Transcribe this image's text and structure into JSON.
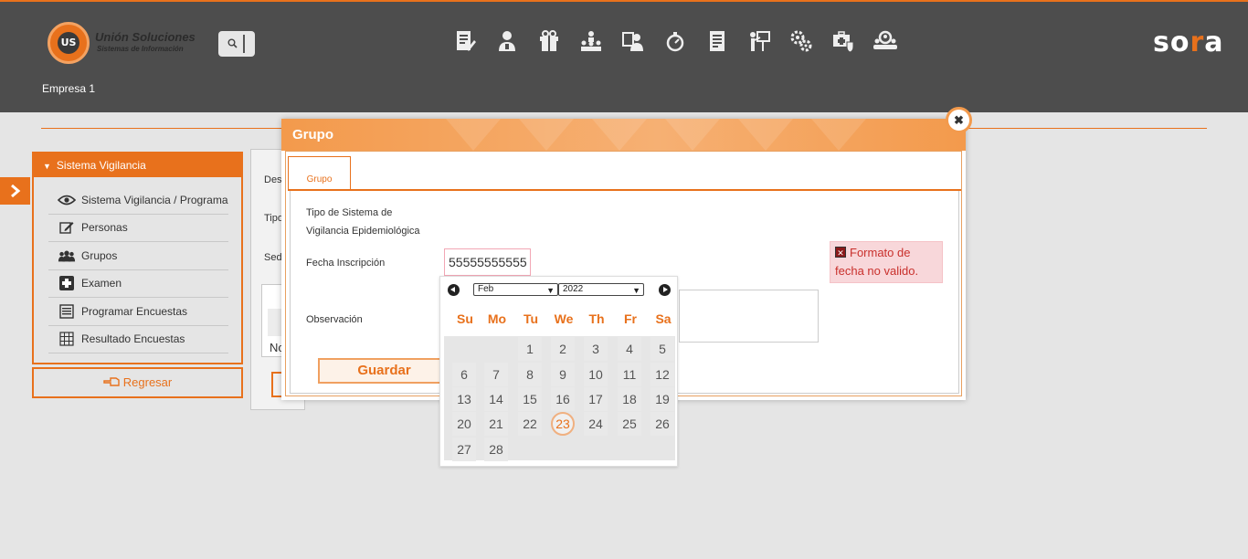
{
  "header": {
    "logo_title": "Unión Soluciones",
    "logo_subtitle": "Sistemas de Información",
    "logo_badge": "US",
    "brand": "sora",
    "company": "Empresa 1",
    "nav_icons": [
      "document-edit-icon",
      "user-edit-icon",
      "gift-icon",
      "org-chart-icon",
      "user-id-icon",
      "stopwatch-icon",
      "report-icon",
      "presentation-icon",
      "gears-icon",
      "medical-kit-icon",
      "team-search-icon"
    ],
    "accent_color": "#e8711c"
  },
  "sidebar": {
    "title": "Sistema Vigilancia",
    "items": [
      {
        "label": "Sistema Vigilancia / Programa",
        "icon": "eye-icon"
      },
      {
        "label": "Personas",
        "icon": "edit-icon"
      },
      {
        "label": "Grupos",
        "icon": "users-icon"
      },
      {
        "label": "Examen",
        "icon": "medical-cross-icon"
      },
      {
        "label": "Programar Encuestas",
        "icon": "list-icon"
      },
      {
        "label": "Resultado Encuestas",
        "icon": "grid-icon"
      }
    ],
    "back_label": "Regresar"
  },
  "background_form": {
    "label_des": "Des",
    "label_tipo": "Tipo",
    "label_sed": "Sed",
    "table_cell": "No"
  },
  "modal": {
    "title": "Grupo",
    "tab_label": "Grupo",
    "tipo_label_line1": "Tipo de Sistema de",
    "tipo_label_line2": "Vigilancia Epidemiológica",
    "fecha_label": "Fecha Inscripción",
    "fecha_value": "55555555555",
    "observacion_label": "Observación",
    "error_line1": "Formato de",
    "error_line2": "fecha no valido.",
    "save_label": "Guardar",
    "close_glyph": "✖"
  },
  "datepicker": {
    "month": "Feb",
    "year": "2022",
    "weekdays": [
      "Su",
      "Mo",
      "Tu",
      "We",
      "Th",
      "Fr",
      "Sa"
    ],
    "first_weekday_index": 2,
    "days_in_month": 28,
    "today": 23
  }
}
